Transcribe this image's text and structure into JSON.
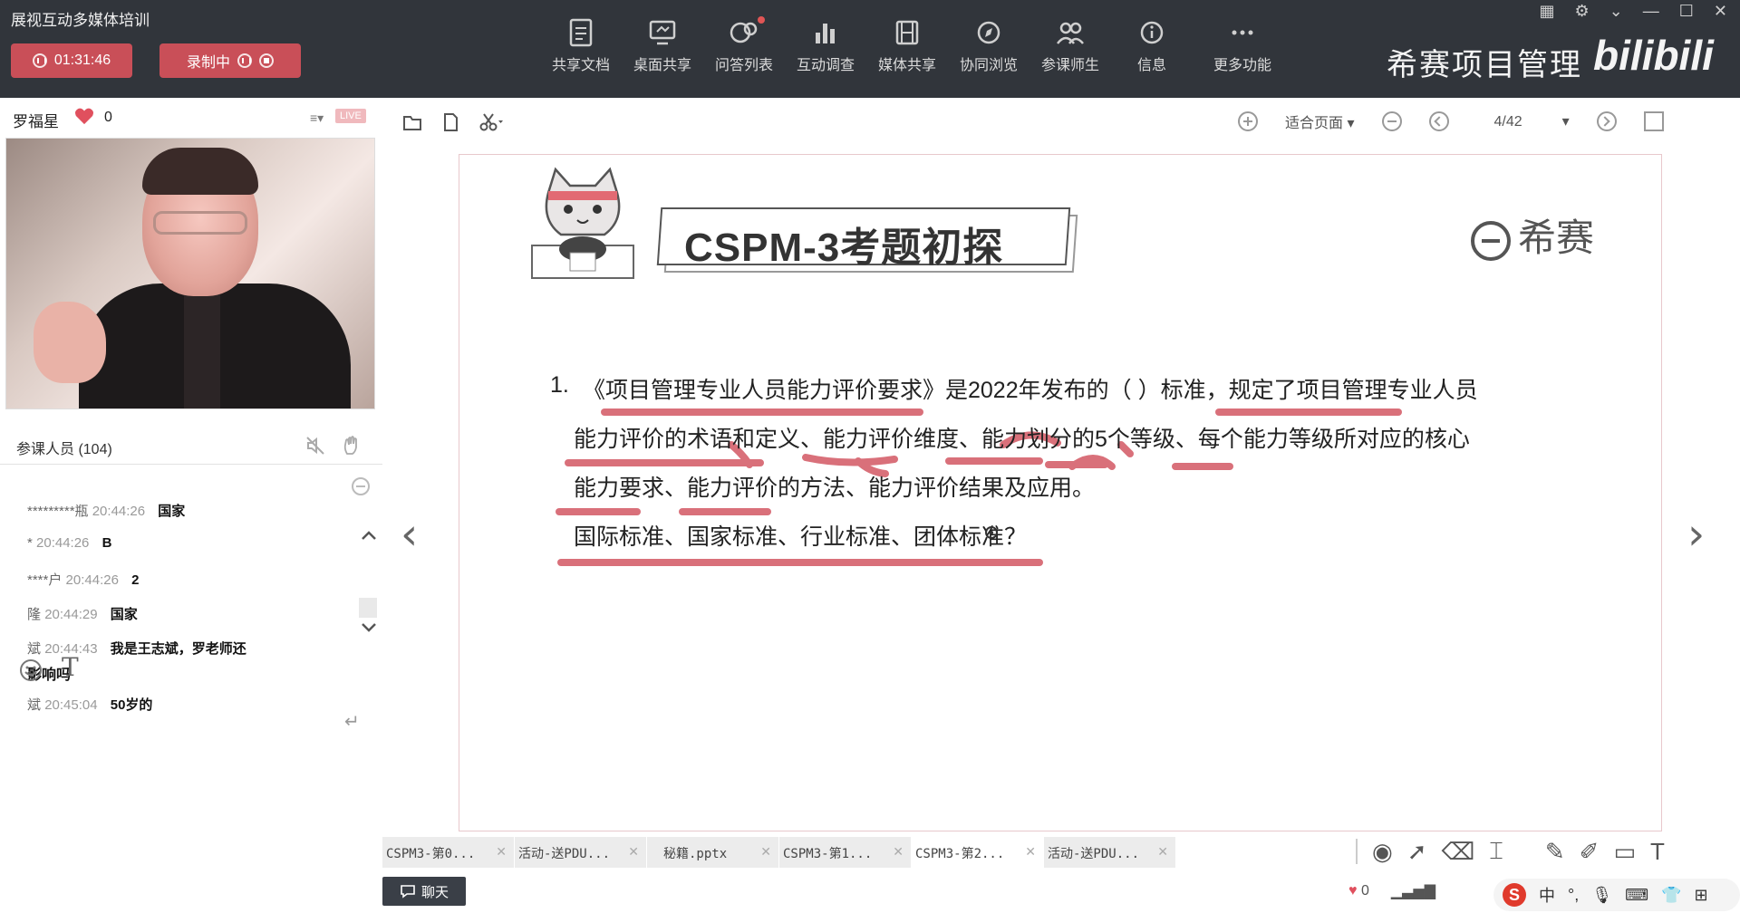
{
  "app": {
    "title": "展视互动多媒体培训"
  },
  "session": {
    "timer": "01:31:46",
    "recording_label": "录制中"
  },
  "toolbar": {
    "items": [
      {
        "label": "共享文档",
        "icon": "document-icon"
      },
      {
        "label": "桌面共享",
        "icon": "desktop-share-icon"
      },
      {
        "label": "问答列表",
        "icon": "qa-icon"
      },
      {
        "label": "互动调查",
        "icon": "survey-chart-icon"
      },
      {
        "label": "媒体共享",
        "icon": "media-film-icon"
      },
      {
        "label": "协同浏览",
        "icon": "compass-icon"
      },
      {
        "label": "参课师生",
        "icon": "users-icon"
      },
      {
        "label": "信息",
        "icon": "info-icon"
      },
      {
        "label": "更多功能",
        "icon": "more-icon"
      }
    ]
  },
  "brand": {
    "name": "希赛项目管理",
    "platform": "bilibili"
  },
  "presenter": {
    "name": "罗福星",
    "likes": "0",
    "live_badge": "LIVE"
  },
  "attendees": {
    "label": "参课人员 (104)"
  },
  "chat": {
    "messages": [
      {
        "user": "*********瓶",
        "time": "20:44:26",
        "text": "国家"
      },
      {
        "user": "*",
        "time": "20:44:26",
        "text": "B"
      },
      {
        "user": "****户",
        "time": "20:44:26",
        "text": "2"
      },
      {
        "user": "隆",
        "time": "20:44:29",
        "text": "国家"
      },
      {
        "user": "斌",
        "time": "20:44:43",
        "text": "我是王志斌，罗老师还",
        "text2": "影响吗"
      },
      {
        "user": "斌",
        "time": "20:45:04",
        "text": "50岁的"
      }
    ],
    "chat_button": "聊天"
  },
  "viewer": {
    "zoom_label": "适合页面",
    "page": "4/42"
  },
  "slide": {
    "title": "CSPM-3考题初探",
    "logo_text": "希赛",
    "question_number": "1.",
    "line1": "《项目管理专业人员能力评价要求》是2022年发布的（  ）标准，规定了项目管理专业人员",
    "line2": "能力评价的术语和定义、能力评价维度、能力划分的5个等级、每个能力等级所对应的核心",
    "line3": "能力要求、能力评价的方法、能力评价结果及应用。",
    "line4": "国际标准、国家标准、行业标准、团体标准？"
  },
  "tabs": [
    {
      "label": "CSPM3-第0..."
    },
    {
      "label": "活动-送PDU..."
    },
    {
      "label": "秘籍.pptx"
    },
    {
      "label": "CSPM3-第1..."
    },
    {
      "label": "CSPM3-第2..."
    },
    {
      "label": "活动-送PDU..."
    }
  ],
  "status": {
    "likes": "0",
    "ime_mode": "中"
  },
  "colors": {
    "accent": "#c94f58",
    "ink": "#d9707a",
    "topbar": "#31353b"
  }
}
